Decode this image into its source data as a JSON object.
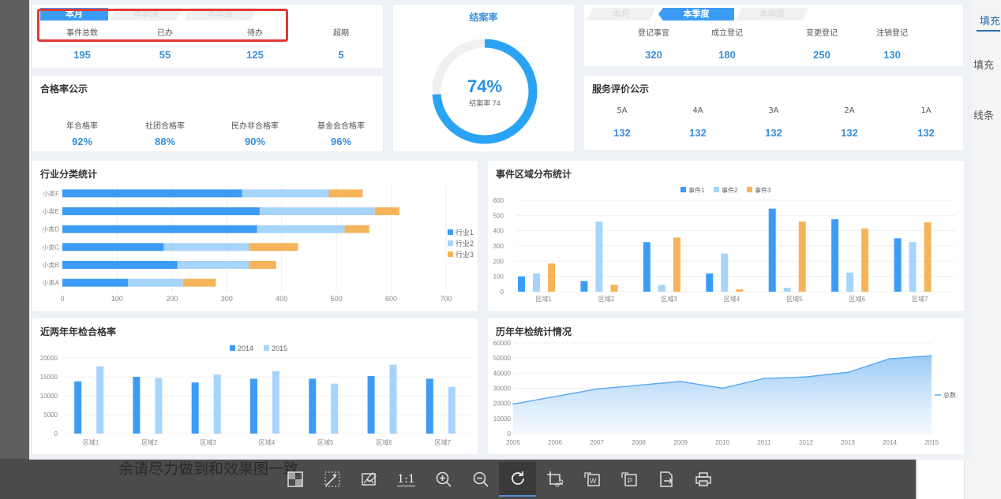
{
  "background": {
    "right_tab": "填充",
    "right_text1": "填充",
    "right_text2": "线条",
    "caption": "余请尽力做到和效果图一致"
  },
  "top_left": {
    "tabs": [
      "本月",
      "本季度",
      "本年度"
    ],
    "active_tab": 0,
    "stats": [
      {
        "label": "事件总数",
        "value": "195"
      },
      {
        "label": "已办",
        "value": "55"
      },
      {
        "label": "待办",
        "value": "125"
      },
      {
        "label": "超期",
        "value": "5"
      }
    ]
  },
  "pass_rate": {
    "title": "合格率公示",
    "stats": [
      {
        "label": "年合格率",
        "value": "92%"
      },
      {
        "label": "社团合格率",
        "value": "88%"
      },
      {
        "label": "民办非合格率",
        "value": "90%"
      },
      {
        "label": "基金会合格率",
        "value": "96%"
      }
    ]
  },
  "close_rate": {
    "title": "结案率",
    "percent_text": "74%",
    "sub_text": "结案率 74",
    "percent": 74,
    "color": "#2aa3f5"
  },
  "top_right": {
    "tabs": [
      "本月",
      "本季度",
      "本年度"
    ],
    "active_tab": 1,
    "stats": [
      {
        "label": "登记事宜",
        "value": "320"
      },
      {
        "label": "成立登记",
        "value": "180"
      },
      {
        "label": "变更登记",
        "value": "250"
      },
      {
        "label": "注销登记",
        "value": "130"
      }
    ]
  },
  "service": {
    "title": "服务评价公示",
    "stats": [
      {
        "label": "5A",
        "value": "132"
      },
      {
        "label": "4A",
        "value": "132"
      },
      {
        "label": "3A",
        "value": "132"
      },
      {
        "label": "2A",
        "value": "132"
      },
      {
        "label": "1A",
        "value": "132"
      }
    ]
  },
  "chart_data": [
    {
      "type": "bar",
      "orientation": "horizontal",
      "stacked": true,
      "title": "行业分类统计",
      "categories": [
        "小类A",
        "小类B",
        "小类C",
        "小类D",
        "小类E",
        "小类F"
      ],
      "series": [
        {
          "name": "行业1",
          "values": [
            120,
            210,
            185,
            355,
            360,
            328
          ],
          "color": "#3c9cf5"
        },
        {
          "name": "行业2",
          "values": [
            100,
            130,
            155,
            160,
            210,
            158
          ],
          "color": "#a7d4fb"
        },
        {
          "name": "行业3",
          "values": [
            60,
            50,
            90,
            45,
            45,
            62
          ],
          "color": "#f5b45a"
        }
      ],
      "xticks": [
        "0",
        "100",
        "200",
        "300",
        "400",
        "500",
        "600",
        "700"
      ],
      "xlim": [
        0,
        700
      ],
      "legend": "right"
    },
    {
      "type": "bar",
      "title": "事件区域分布统计",
      "categories": [
        "区域1",
        "区域2",
        "区域3",
        "区域4",
        "区域5",
        "区域6",
        "区域7"
      ],
      "series": [
        {
          "name": "事件1",
          "values": [
            100,
            70,
            325,
            120,
            545,
            475,
            350
          ],
          "color": "#3c9cf5"
        },
        {
          "name": "事件2",
          "values": [
            120,
            460,
            45,
            250,
            25,
            125,
            325
          ],
          "color": "#a7d4fb"
        },
        {
          "name": "事件3",
          "values": [
            185,
            45,
            355,
            15,
            460,
            415,
            455
          ],
          "color": "#f5b45a"
        }
      ],
      "yticks": [
        "0",
        "100",
        "200",
        "300",
        "400",
        "500",
        "600"
      ],
      "ylim": [
        0,
        600
      ],
      "legend": "top"
    },
    {
      "type": "bar",
      "title": "近两年年检合格率",
      "categories": [
        "区域1",
        "区域2",
        "区域3",
        "区域4",
        "区域5",
        "区域6",
        "区域7"
      ],
      "series": [
        {
          "name": "2014",
          "values": [
            13800,
            15000,
            13500,
            14500,
            14500,
            15200,
            14500
          ],
          "color": "#3c9cf5"
        },
        {
          "name": "2015",
          "values": [
            17800,
            14700,
            15600,
            16500,
            13200,
            18200,
            12300
          ],
          "color": "#a7d4fb"
        }
      ],
      "yticks": [
        "0",
        "5000",
        "10000",
        "15000",
        "20000"
      ],
      "ylim": [
        0,
        20000
      ],
      "legend": "top"
    },
    {
      "type": "area",
      "title": "历年年检统计情况",
      "x": [
        "2005",
        "2006",
        "2007",
        "2008",
        "2009",
        "2010",
        "2011",
        "2012",
        "2013",
        "2014",
        "2015"
      ],
      "series": [
        {
          "name": "总数",
          "values": [
            19500,
            24500,
            29500,
            32000,
            34500,
            30000,
            36500,
            37500,
            40500,
            49500,
            51500
          ],
          "color": "#5aa8f2"
        }
      ],
      "yticks": [
        "0",
        "10000",
        "20000",
        "30000",
        "40000",
        "50000",
        "60000"
      ],
      "ylim": [
        0,
        60000
      ],
      "legend": "right"
    }
  ],
  "toolbar": {
    "tools": [
      "split-view-icon",
      "magic-select-icon",
      "edit-image-icon",
      "actual-size-icon",
      "zoom-in-icon",
      "zoom-out-icon",
      "rotate-icon",
      "crop-icon",
      "image-to-word-icon",
      "image-to-ppt-icon",
      "export-icon",
      "print-icon"
    ],
    "actual_size_label": "1:1"
  }
}
